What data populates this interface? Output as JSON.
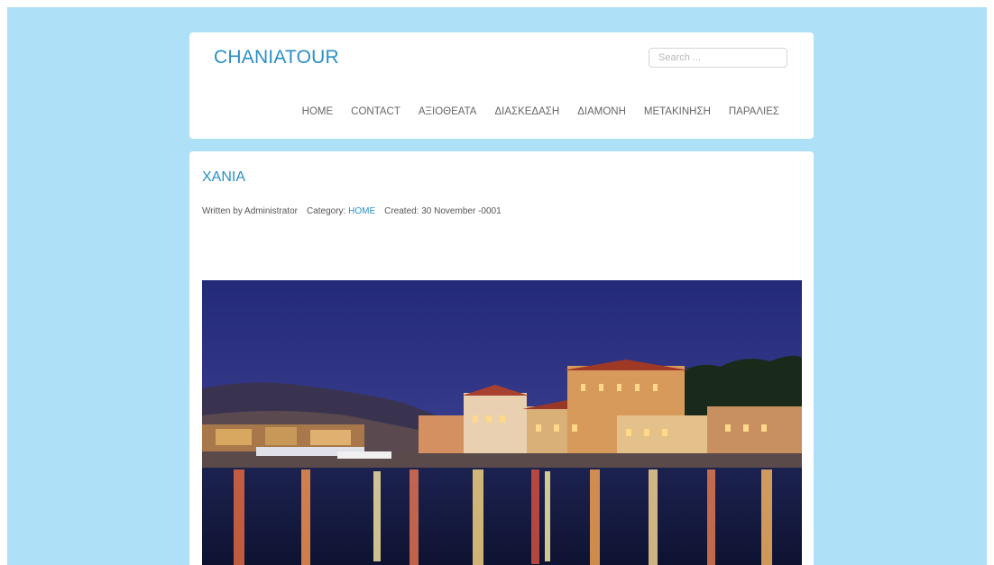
{
  "site": {
    "logo": "CHANIATOUR",
    "search_placeholder": "Search ..."
  },
  "nav": {
    "items": [
      {
        "label": "HOME"
      },
      {
        "label": "CONTACT"
      },
      {
        "label": "ΑΞΙΟΘΕΑΤΑ"
      },
      {
        "label": "ΔΙΑΣΚΕΔΑΣΗ"
      },
      {
        "label": "ΔΙΑΜΟΝΗ"
      },
      {
        "label": "ΜΕΤΑΚΙΝΗΣΗ"
      },
      {
        "label": "ΠΑΡΑΛΙΕΣ"
      }
    ]
  },
  "article": {
    "title": "ΧΑΝΙΑ",
    "written_by": "Written by Administrator",
    "category_label": "Category:",
    "category_value": "HOME",
    "created": "Created: 30 November -0001"
  },
  "colors": {
    "background": "#aee0f8",
    "accent": "#2a8fc6",
    "card": "#ffffff"
  }
}
